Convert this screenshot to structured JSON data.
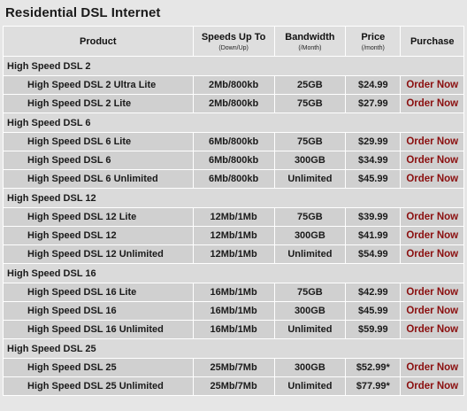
{
  "page_title": "Residential DSL Internet",
  "header": {
    "product": "Product",
    "speed": "Speeds Up To",
    "speed_sub": "(Down/Up)",
    "bandwidth": "Bandwidth",
    "bandwidth_sub": "(/Month)",
    "price": "Price",
    "price_sub": "(/month)",
    "purchase": "Purchase"
  },
  "order_label": "Order Now",
  "groups": [
    {
      "name": "High Speed DSL 2",
      "plans": [
        {
          "name": "High Speed DSL 2 Ultra Lite",
          "speed": "2Mb/800kb",
          "bandwidth": "25GB",
          "price": "$24.99"
        },
        {
          "name": "High Speed DSL 2 Lite",
          "speed": "2Mb/800kb",
          "bandwidth": "75GB",
          "price": "$27.99"
        }
      ]
    },
    {
      "name": "High Speed DSL 6",
      "plans": [
        {
          "name": "High Speed DSL 6 Lite",
          "speed": "6Mb/800kb",
          "bandwidth": "75GB",
          "price": "$29.99"
        },
        {
          "name": "High Speed DSL 6",
          "speed": "6Mb/800kb",
          "bandwidth": "300GB",
          "price": "$34.99"
        },
        {
          "name": "High Speed DSL 6 Unlimited",
          "speed": "6Mb/800kb",
          "bandwidth": "Unlimited",
          "price": "$45.99"
        }
      ]
    },
    {
      "name": "High Speed DSL 12",
      "plans": [
        {
          "name": "High Speed DSL 12 Lite",
          "speed": "12Mb/1Mb",
          "bandwidth": "75GB",
          "price": "$39.99"
        },
        {
          "name": "High Speed DSL 12",
          "speed": "12Mb/1Mb",
          "bandwidth": "300GB",
          "price": "$41.99"
        },
        {
          "name": "High Speed DSL 12 Unlimited",
          "speed": "12Mb/1Mb",
          "bandwidth": "Unlimited",
          "price": "$54.99"
        }
      ]
    },
    {
      "name": "High Speed DSL 16",
      "plans": [
        {
          "name": "High Speed DSL 16 Lite",
          "speed": "16Mb/1Mb",
          "bandwidth": "75GB",
          "price": "$42.99"
        },
        {
          "name": "High Speed DSL 16",
          "speed": "16Mb/1Mb",
          "bandwidth": "300GB",
          "price": "$45.99"
        },
        {
          "name": "High Speed DSL 16 Unlimited",
          "speed": "16Mb/1Mb",
          "bandwidth": "Unlimited",
          "price": "$59.99"
        }
      ]
    },
    {
      "name": "High Speed DSL 25",
      "plans": [
        {
          "name": "High Speed DSL 25",
          "speed": "25Mb/7Mb",
          "bandwidth": "300GB",
          "price": "$52.99*"
        },
        {
          "name": "High Speed DSL 25 Unlimited",
          "speed": "25Mb/7Mb",
          "bandwidth": "Unlimited",
          "price": "$77.99*"
        }
      ]
    }
  ]
}
